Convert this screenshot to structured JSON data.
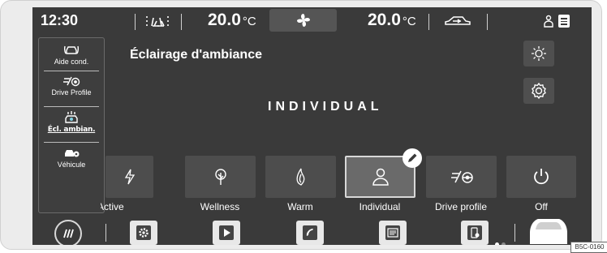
{
  "status_bar": {
    "time": "12:30",
    "temp_left_value": "20.0",
    "temp_right_value": "20.0",
    "temp_unit": "°C"
  },
  "left_panel": {
    "items": [
      {
        "label": "Aide cond.",
        "icon": "driver-assist-icon"
      },
      {
        "label": "Drive Profile",
        "icon": "drive-profile-icon"
      },
      {
        "label": "Écl. ambian.",
        "icon": "ambient-light-icon",
        "active": true
      },
      {
        "label": "Véhicule",
        "icon": "vehicle-icon"
      }
    ]
  },
  "main": {
    "title": "Éclairage d'ambiance",
    "mode": "INDIVIDUAL",
    "tiles": [
      {
        "label": "Active",
        "icon": "lightning-icon"
      },
      {
        "label": "Wellness",
        "icon": "tree-icon"
      },
      {
        "label": "Warm",
        "icon": "flame-icon"
      },
      {
        "label": "Individual",
        "icon": "person-icon",
        "selected": true
      },
      {
        "label": "Drive profile",
        "icon": "drive-profile-icon"
      },
      {
        "label": "Off",
        "icon": "power-icon"
      }
    ]
  },
  "image_code": "B5C-0160",
  "colors": {
    "screen_bg": "#3a3a3a",
    "tile_bg": "#4d4d4d",
    "text": "#ffffff"
  }
}
